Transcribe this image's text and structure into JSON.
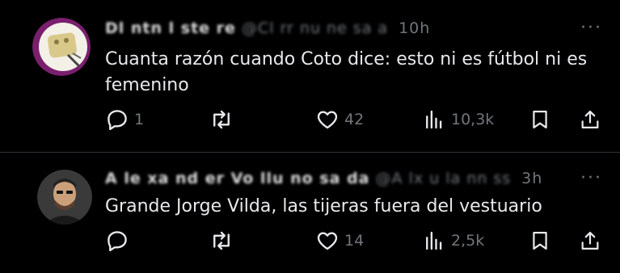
{
  "tweets": [
    {
      "display_name": "Dl ntn l ste re",
      "handle": "@Cl rr nu ne sa a",
      "time": "10h",
      "text": "Cuanta razón cuando Coto dice: esto ni es fútbol ni es femenino",
      "replies": "1",
      "reposts": "",
      "likes": "42",
      "views": "10,3k"
    },
    {
      "display_name": "A le xa nd er Vo llu no sa da",
      "handle": "@A lx u la nn ss",
      "time": "3h",
      "text": "Grande Jorge Vilda, las tijeras fuera del vestuario",
      "replies": "",
      "reposts": "",
      "likes": "14",
      "views": "2,5k"
    }
  ],
  "more_label": "···",
  "colors": {
    "background": "#000000",
    "text": "#e7e9ea",
    "muted": "#71767b",
    "divider": "#2f3336"
  }
}
